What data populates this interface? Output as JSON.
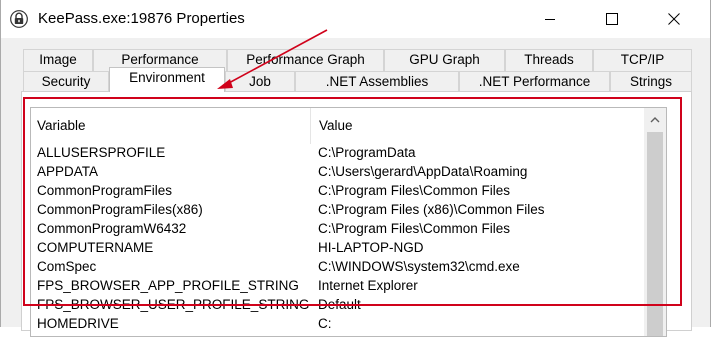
{
  "window": {
    "title": "KeePass.exe:19876 Properties",
    "icons": {
      "app": "keepass-lock-icon",
      "minimize": "minimize-icon",
      "maximize": "maximize-icon",
      "close": "close-icon"
    }
  },
  "tabs": {
    "row1": [
      "Image",
      "Performance",
      "Performance Graph",
      "GPU Graph",
      "Threads",
      "TCP/IP"
    ],
    "row2": [
      "Security",
      "Environment",
      "Job",
      ".NET Assemblies",
      ".NET Performance",
      "Strings"
    ],
    "active": "Environment"
  },
  "list": {
    "columns": {
      "variable": "Variable",
      "value": "Value"
    },
    "rows": [
      {
        "variable": "ALLUSERSPROFILE",
        "value": "C:\\ProgramData"
      },
      {
        "variable": "APPDATA",
        "value": "C:\\Users\\gerard\\AppData\\Roaming"
      },
      {
        "variable": "CommonProgramFiles",
        "value": "C:\\Program Files\\Common Files"
      },
      {
        "variable": "CommonProgramFiles(x86)",
        "value": "C:\\Program Files (x86)\\Common Files"
      },
      {
        "variable": "CommonProgramW6432",
        "value": "C:\\Program Files\\Common Files"
      },
      {
        "variable": "COMPUTERNAME",
        "value": "HI-LAPTOP-NGD"
      },
      {
        "variable": "ComSpec",
        "value": "C:\\WINDOWS\\system32\\cmd.exe"
      },
      {
        "variable": "FPS_BROWSER_APP_PROFILE_STRING",
        "value": "Internet Explorer"
      },
      {
        "variable": "FPS_BROWSER_USER_PROFILE_STRING",
        "value": "Default"
      },
      {
        "variable": "HOMEDRIVE",
        "value": "C:"
      }
    ],
    "scroll_up_icon": "chevron-up-icon"
  },
  "annotation": {
    "color": "#d0021b"
  }
}
